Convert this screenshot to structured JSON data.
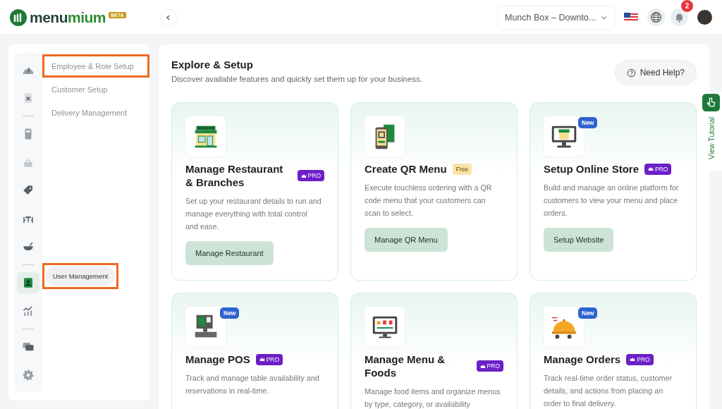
{
  "header": {
    "logo": {
      "part_1": "menu",
      "part_2": "mium",
      "badge": "BETA"
    },
    "store_select": {
      "value": "Munch Box – Downto..."
    },
    "notifications": {
      "count": "2"
    }
  },
  "rail": [
    {
      "kind": "icon",
      "selected": false
    },
    {
      "kind": "icon",
      "selected": false
    },
    {
      "kind": "divider"
    },
    {
      "kind": "icon",
      "selected": false
    },
    {
      "kind": "icon",
      "selected": false
    },
    {
      "kind": "icon",
      "selected": false
    },
    {
      "kind": "icon",
      "selected": false
    },
    {
      "kind": "icon",
      "selected": false
    },
    {
      "kind": "divider"
    },
    {
      "kind": "icon",
      "selected": true
    },
    {
      "kind": "icon",
      "selected": false
    },
    {
      "kind": "divider"
    },
    {
      "kind": "icon",
      "selected": false
    },
    {
      "kind": "icon",
      "selected": false
    }
  ],
  "submenu": [
    {
      "label": "Employee & Role Setup",
      "highlighted": true
    },
    {
      "label": "Customer Setup",
      "highlighted": false
    },
    {
      "label": "Delivery Management",
      "highlighted": false
    }
  ],
  "flyout": {
    "label": "User Management",
    "highlighted": true
  },
  "main": {
    "title": "Explore & Setup",
    "subtitle": "Discover available features and quickly set them up for your business.",
    "help_button": "Need Help?",
    "cards": [
      {
        "title": "Manage Restaurant & Branches",
        "plan": {
          "kind": "pro",
          "label": "PRO"
        },
        "description": "Set up your restaurant details to run and manage everything with total control and ease.",
        "button": "Manage Restaurant"
      },
      {
        "title": "Create QR Menu",
        "plan": {
          "kind": "free",
          "label": "Free"
        },
        "description": "Execute touchless ordering with a QR code menu that your customers can scan to select.",
        "button": "Manage QR Menu"
      },
      {
        "new_badge": "New",
        "title": "Setup Online Store",
        "plan": {
          "kind": "pro",
          "label": "PRO"
        },
        "description": "Build and manage an online platform for customers to view your menu and place orders.",
        "button": "Setup Website"
      },
      {
        "new_badge": "New",
        "title": "Manage POS",
        "plan": {
          "kind": "pro",
          "label": "PRO"
        },
        "description": "Track and manage table availability and reservations in real-time."
      },
      {
        "title": "Manage Menu & Foods",
        "plan": {
          "kind": "pro",
          "label": "PRO"
        },
        "description": "Manage food items and organize menus by type, category, or availability"
      },
      {
        "new_badge": "New",
        "title": "Manage Orders",
        "plan": {
          "kind": "pro",
          "label": "PRO"
        },
        "description": "Track real-time order status, customer details, and actions from placing an order to final delivery."
      }
    ]
  },
  "tutorial_tab": {
    "label": "View Tutorial"
  }
}
